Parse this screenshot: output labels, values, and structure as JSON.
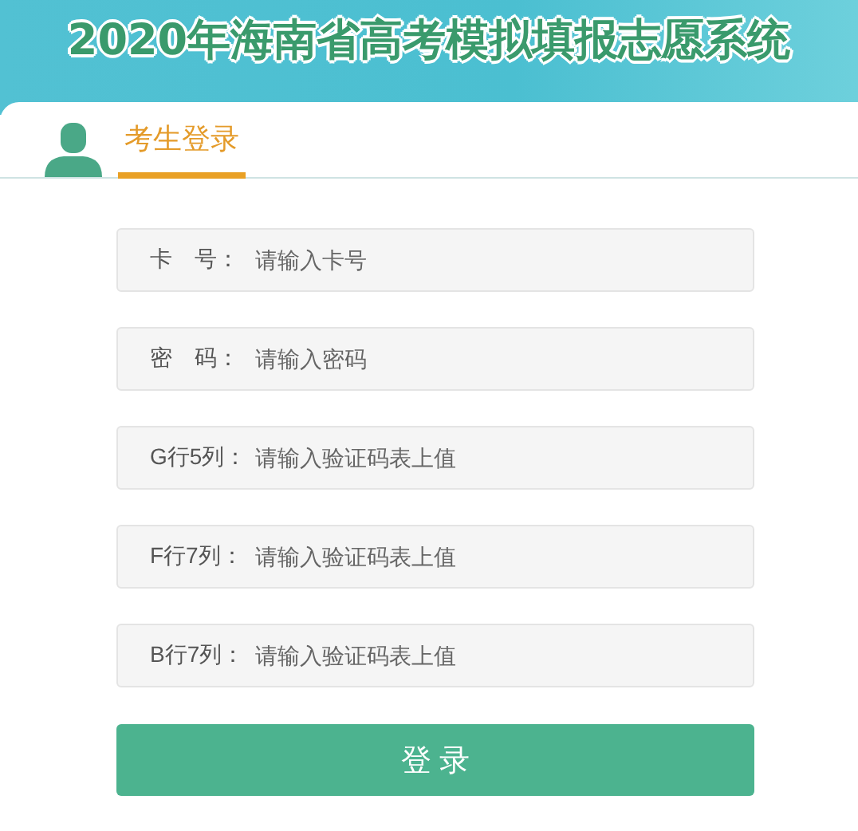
{
  "header": {
    "title": "2020年海南省高考模拟填报志愿系统"
  },
  "tabs": [
    {
      "label": "考生登录",
      "selected": true
    }
  ],
  "fields": [
    {
      "label": "卡　号：",
      "placeholder": "请输入卡号"
    },
    {
      "label": "密　码：",
      "placeholder": "请输入密码"
    },
    {
      "label": "G行5列：",
      "placeholder": "请输入验证码表上值"
    },
    {
      "label": "F行7列：",
      "placeholder": "请输入验证码表上值"
    },
    {
      "label": "B行7列：",
      "placeholder": "请输入验证码表上值"
    }
  ],
  "login_button": {
    "label": "登 录"
  }
}
